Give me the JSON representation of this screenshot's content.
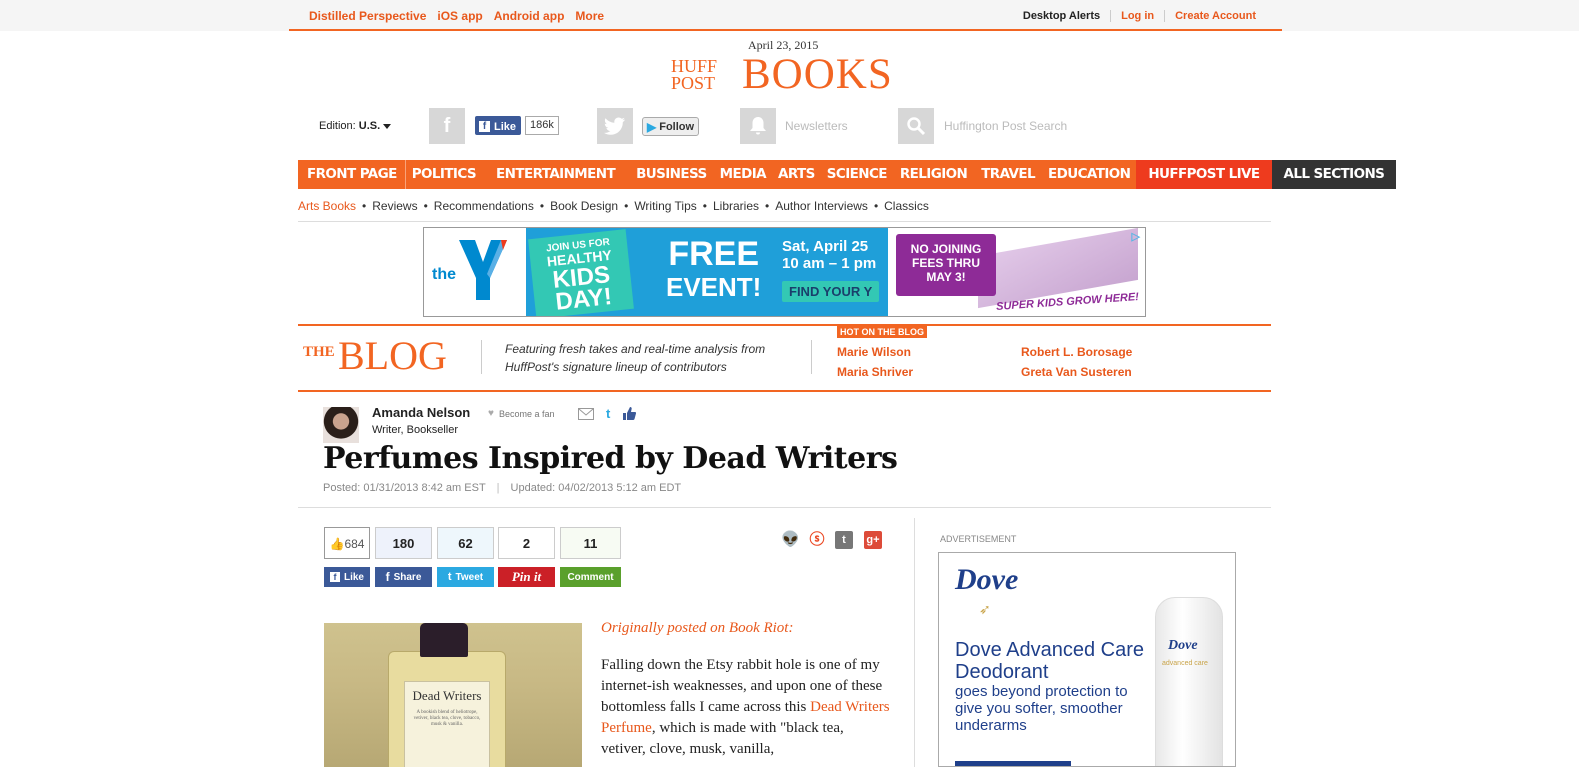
{
  "topbar": {
    "left_links": [
      "Distilled Perspective",
      "iOS app",
      "Android app",
      "More"
    ],
    "alerts": "Desktop Alerts",
    "login": "Log in",
    "create": "Create Account"
  },
  "masthead": {
    "date": "April 23, 2015",
    "logo_huff": "HUFF",
    "logo_post": "POST",
    "section": "BOOKS"
  },
  "social": {
    "edition_label": "Edition:",
    "edition_value": "U.S.",
    "like_label": "Like",
    "like_count": "186k",
    "follow_label": "Follow",
    "newsletters": "Newsletters",
    "search": "Huffington Post Search"
  },
  "nav": {
    "items": [
      "FRONT PAGE",
      "POLITICS",
      "ENTERTAINMENT",
      "BUSINESS",
      "MEDIA",
      "ARTS",
      "SCIENCE",
      "RELIGION",
      "TRAVEL",
      "EDUCATION"
    ],
    "live": "HUFFPOST LIVE",
    "all": "ALL SECTIONS"
  },
  "subnav": {
    "active": "Arts Books",
    "items": [
      "Reviews",
      "Recommendations",
      "Book Design",
      "Writing Tips",
      "Libraries",
      "Author Interviews",
      "Classics"
    ]
  },
  "banner_ad": {
    "the": "the",
    "kids_line1": "JOIN US FOR",
    "kids_line2": "HEALTHY",
    "kids_line3": "KIDS",
    "kids_line4": "DAY!",
    "free": "FREE",
    "event": "EVENT!",
    "date_line1": "Sat, April 25",
    "date_line2": "10 am – 1 pm",
    "find": "FIND YOUR Y",
    "nojoin": "NO JOINING FEES THRU MAY 3!",
    "super": "SUPER KIDS GROW HERE!"
  },
  "blog": {
    "the": "THE",
    "word": "BLOG",
    "tagline": "Featuring fresh takes and real-time analysis from HuffPost's signature lineup of contributors",
    "hot_label": "HOT ON THE BLOG",
    "hot_links": [
      "Marie Wilson",
      "Maria Shriver",
      "Robert L. Borosage",
      "Greta Van Susteren"
    ]
  },
  "author": {
    "name": "Amanda Nelson",
    "become_fan": "Become a fan",
    "role": "Writer, Bookseller"
  },
  "article": {
    "headline": "Perfumes Inspired by Dead Writers",
    "posted": "Posted: 01/31/2013 8:42 am EST",
    "updated": "Updated: 04/02/2013 5:12 am EDT",
    "origin": "Originally posted on Book Riot:",
    "para_before_link": "Falling down the Etsy rabbit hole is one of my internet-ish weaknesses, and upon one of these bottomless falls I came across this ",
    "link_text": "Dead Writers Perfume",
    "para_after_link": ", which is made with \"black tea, vetiver, clove, musk, vanilla,",
    "photo_label_title": "Dead Writers",
    "photo_label_small": "A bookish blend of heliotrope, vetiver, black tea, clove, tobacco, musk & vanilla."
  },
  "share": {
    "likes": "684",
    "counts": [
      "180",
      "62",
      "2",
      "11"
    ],
    "buttons": [
      "Like",
      "Share",
      "Tweet",
      "Pin it",
      "Comment"
    ]
  },
  "side_ad": {
    "label": "ADVERTISEMENT",
    "brand": "Dove",
    "title": "Dove Advanced Care Deodorant",
    "desc": "goes beyond protection to give you softer, smoother underarms",
    "product_brand": "Dove",
    "product_line": "advanced care"
  },
  "colors": {
    "accent": "#f26522",
    "link": "#e8581c",
    "facebook": "#3b5998",
    "twitter": "#2ba9e1",
    "pinterest": "#cb2027",
    "comment": "#5aa02c"
  }
}
